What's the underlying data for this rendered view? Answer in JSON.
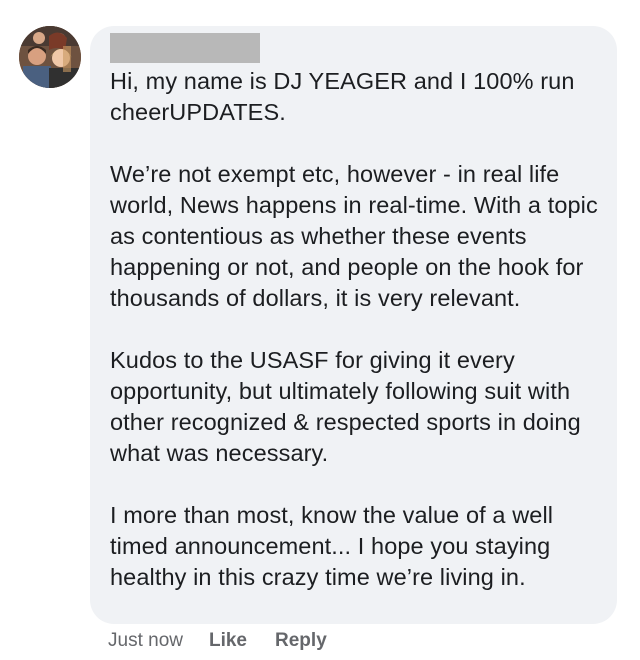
{
  "comment": {
    "author_name": "",
    "paragraphs": [
      "Hi, my name is DJ YEAGER and I 100% run cheerUPDATES.",
      "We’re not exempt etc, however - in real life world, News happens in real-time. With a topic as contentious as whether these events happening or not, and people on the hook for thousands of dollars, it is very relevant.",
      "Kudos to the USASF for giving it every opportunity, but ultimately following suit with other recognized & respected sports in doing what was necessary.",
      "I more than most, know the value of a well timed announcement... I hope you staying healthy in this crazy time we’re living in."
    ],
    "timestamp": "Just now",
    "like_label": "Like",
    "reply_label": "Reply"
  },
  "colors": {
    "bubble_bg": "#f0f2f5",
    "text": "#1c1e21",
    "meta": "#65676b",
    "redacted": "#b8b8b8"
  },
  "icons": {
    "avatar": "profile-photo-group"
  }
}
